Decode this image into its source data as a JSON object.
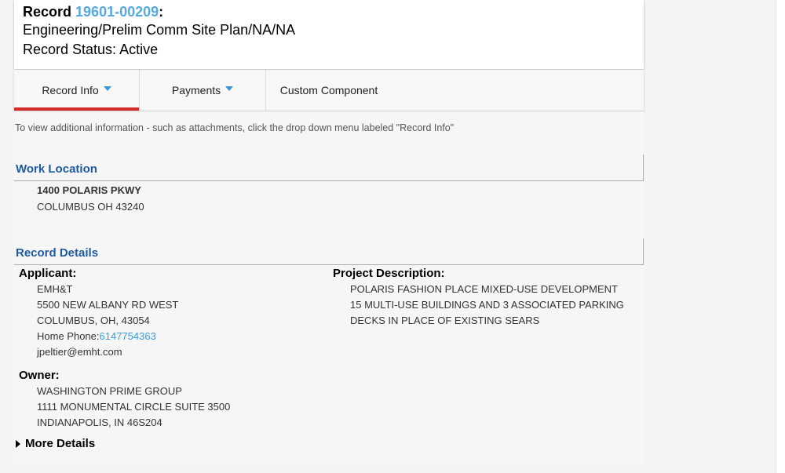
{
  "header": {
    "record_prefix": "Record",
    "record_number": "19601-00209",
    "record_suffix": ":",
    "record_type": "Engineering/Prelim Comm Site Plan/NA/NA",
    "record_status": "Record Status: Active"
  },
  "tabs": [
    {
      "label": "Record Info",
      "has_dropdown": true,
      "active": true
    },
    {
      "label": "Payments",
      "has_dropdown": true,
      "active": false
    },
    {
      "label": "Custom Component",
      "has_dropdown": false,
      "active": false
    }
  ],
  "hint": "To view additional information - such as attachments, click the drop down menu labeled \"Record Info\"",
  "work_location": {
    "title": "Work Location",
    "address_line1": "1400 POLARIS PKWY",
    "address_line2": "COLUMBUS OH 43240"
  },
  "record_details": {
    "title": "Record Details",
    "applicant": {
      "label": "Applicant:",
      "name": "EMH&T",
      "street": "5500 NEW ALBANY RD WEST",
      "city": "COLUMBUS, OH, 43054",
      "phone_label": "Home Phone:",
      "phone": "6147754363",
      "email": "jpeltier@emht.com"
    },
    "owner": {
      "label": "Owner:",
      "name": "WASHINGTON PRIME GROUP",
      "street": "1111 MONUMENTAL CIRCLE SUITE 3500",
      "city": "INDIANAPOLIS, IN 46S204"
    },
    "project_description": {
      "label": "Project Description:",
      "line1": "POLARIS FASHION PLACE MIXED-USE DEVELOPMENT",
      "line2": "15 MULTI-USE BUILDINGS AND 3 ASSOCIATED PARKING",
      "line3": "DECKS IN PLACE OF EXISTING SEARS"
    }
  },
  "more_details": "More Details",
  "colors": {
    "accent_link": "#56a8e0",
    "section_title": "#1e5aa0",
    "active_tab_underline": "#d42a2a"
  }
}
